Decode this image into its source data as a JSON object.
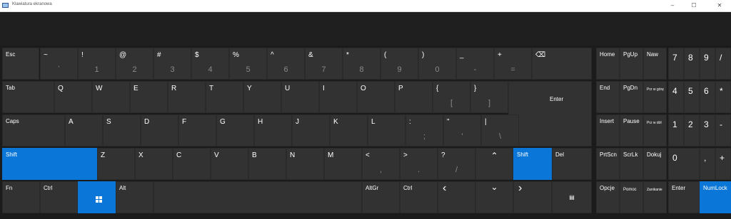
{
  "window": {
    "title": "Klawiatura ekranowa",
    "minimize": "–",
    "maximize": "☐",
    "close": "✕"
  },
  "keys": {
    "esc": "Esc",
    "tilde": "~",
    "backtick": "`",
    "exclam": "!",
    "one": "1",
    "at": "@",
    "two": "2",
    "hash": "#",
    "three": "3",
    "dollar": "$",
    "four": "4",
    "percent": "%",
    "five": "5",
    "caret": "^",
    "six": "6",
    "amp": "&",
    "seven": "7",
    "star": "*",
    "eight": "8",
    "lparen": "(",
    "nine": "9",
    "rparen": ")",
    "zero": "0",
    "underscore": "_",
    "minus": "-",
    "plus": "+",
    "equals": "=",
    "backspace": "⌫",
    "tab": "Tab",
    "q": "Q",
    "w": "W",
    "e": "E",
    "r": "R",
    "t": "T",
    "y": "Y",
    "u": "U",
    "i": "I",
    "o": "O",
    "p": "P",
    "lbrace": "{",
    "lbracket": "[",
    "rbrace": "}",
    "rbracket": "]",
    "enter": "Enter",
    "caps": "Caps",
    "a": "A",
    "s": "S",
    "d": "D",
    "f": "F",
    "g": "G",
    "h": "H",
    "j": "J",
    "k": "K",
    "l": "L",
    "colon": ":",
    "semicolon": ";",
    "quote": "\"",
    "apos": "'",
    "pipe": "|",
    "backslash": "\\",
    "shift": "Shift",
    "z": "Z",
    "x": "X",
    "c": "C",
    "v": "V",
    "b": "B",
    "n": "N",
    "m": "M",
    "lt": "<",
    "comma": ",",
    "gt": ">",
    "period": ".",
    "question": "?",
    "slash": "/",
    "up": "⌃",
    "del": "Del",
    "fn": "Fn",
    "ctrl": "Ctrl",
    "alt": "Alt",
    "altgr": "AltGr",
    "left": "‹",
    "down": "⌄",
    "right": "›",
    "menu": "▤",
    "home": "Home",
    "pgup": "PgUp",
    "naw": "Naw",
    "end": "End",
    "pgdn": "PgDn",
    "przgore": "Prz w górę",
    "insert": "Insert",
    "pause": "Pause",
    "przdol": "Prz w dół",
    "prtscn": "PrtScn",
    "scrlk": "ScrLk",
    "dokuj": "Dokuj",
    "opcje": "Opcje",
    "pomoc": "Pomoc",
    "zanikanie": "Zanikanie",
    "n7": "7",
    "n8": "8",
    "n9": "9",
    "nslash": "/",
    "n4": "4",
    "n5": "5",
    "n6": "6",
    "nstar": "*",
    "n1": "1",
    "n2": "2",
    "n3": "3",
    "nminus": "-",
    "n0": "0",
    "ndot": ",",
    "nplus": "+",
    "numenter": "Enter",
    "numlock": "NumLock"
  },
  "colors": {
    "accent": "#0a76d8",
    "key": "#323232",
    "background": "#1b1b1b"
  }
}
